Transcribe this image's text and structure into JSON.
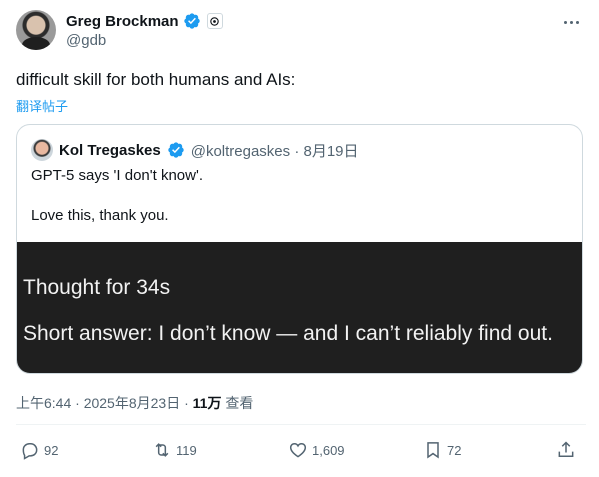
{
  "author": {
    "name": "Greg Brockman",
    "handle": "@gdb"
  },
  "tweet": {
    "text": "difficult skill for both humans and AIs:",
    "translate_label": "翻译帖子"
  },
  "quoted": {
    "name": "Kol Tregaskes",
    "handle_date": "@koltregaskes · 8月19日",
    "line1": "GPT-5 says 'I don't know'.",
    "line2": "Love this, thank you.",
    "image_line1": "Thought for 34s",
    "image_line2": "Short answer: I don’t know — and I can’t reliably find out."
  },
  "meta": {
    "time_date": "上午6:44 · 2025年8月23日 · ",
    "views_count": "11万",
    "views_label": " 查看"
  },
  "actions": {
    "replies": "92",
    "reposts": "119",
    "likes": "1,609",
    "bookmarks": "72"
  },
  "colors": {
    "verified": "#1d9bf0",
    "secondary_text": "#536471",
    "link": "#1d9bf0"
  },
  "icons": [
    "verified-badge-icon",
    "affiliation-badge-icon",
    "more-options-icon",
    "reply-icon",
    "repost-icon",
    "like-icon",
    "bookmark-icon",
    "share-icon"
  ]
}
